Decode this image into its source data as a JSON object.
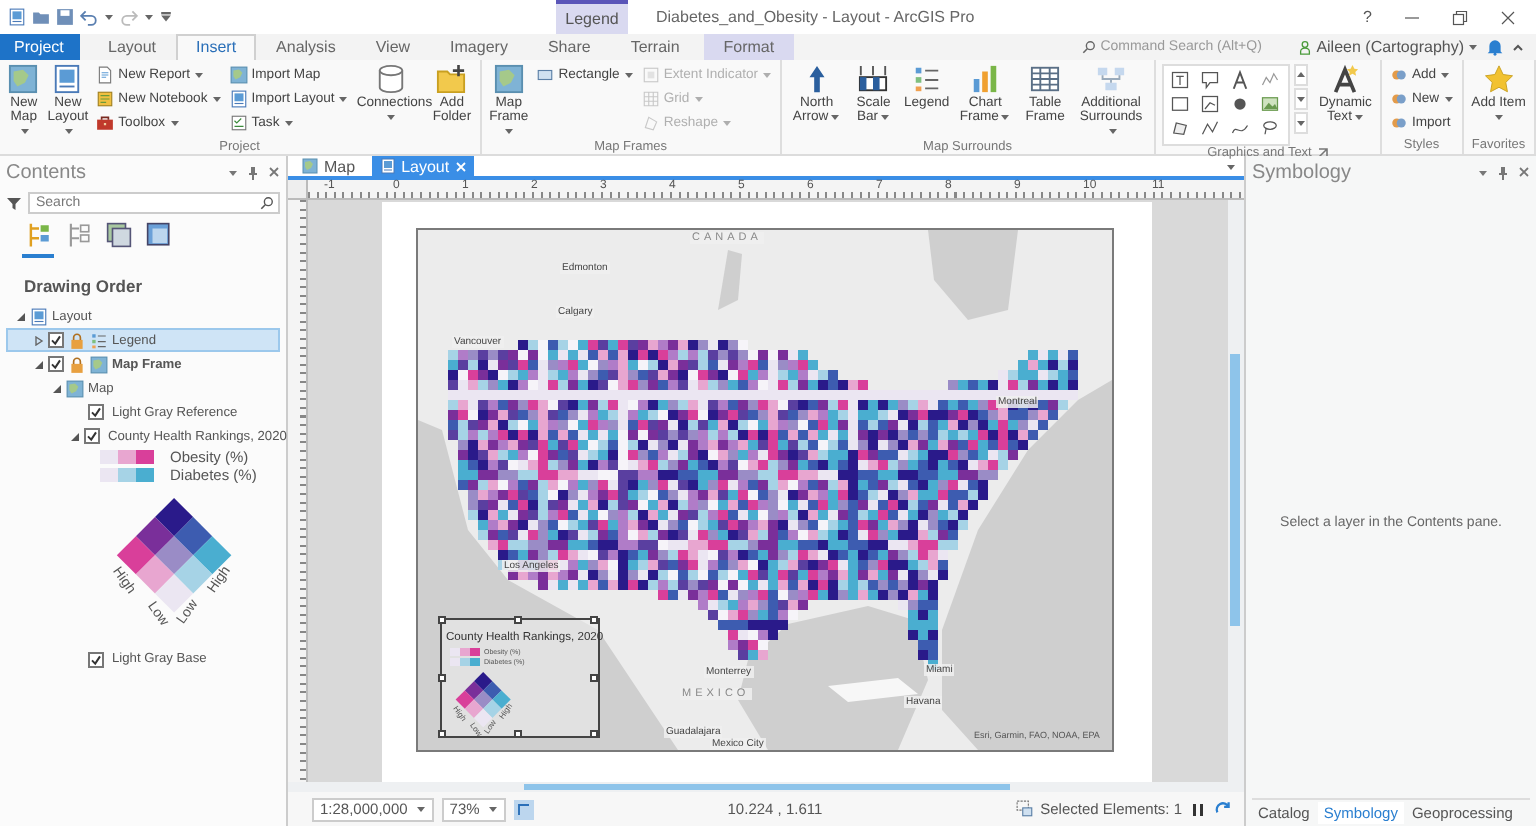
{
  "title_bar": {
    "context_label": "Legend",
    "title": "Diabetes_and_Obesity - Layout - ArcGIS Pro",
    "help": "?"
  },
  "ribbon_tabs": [
    {
      "label": "Project",
      "kind": "backstage",
      "selected": false
    },
    {
      "label": "Layout",
      "kind": "normal",
      "selected": false
    },
    {
      "label": "Insert",
      "kind": "normal",
      "selected": true
    },
    {
      "label": "Analysis",
      "kind": "normal",
      "selected": false
    },
    {
      "label": "View",
      "kind": "normal",
      "selected": false
    },
    {
      "label": "Imagery",
      "kind": "normal",
      "selected": false
    },
    {
      "label": "Share",
      "kind": "normal",
      "selected": false
    },
    {
      "label": "Terrain",
      "kind": "normal",
      "selected": false
    },
    {
      "label": "Format",
      "kind": "contextual",
      "selected": false
    }
  ],
  "command_search": {
    "placeholder": "Command Search (Alt+Q)"
  },
  "user": {
    "label": "Aileen (Cartography)",
    "dropdown": true
  },
  "ribbon_groups": [
    {
      "label": "Project",
      "launcher": false,
      "items": [
        {
          "kind": "large",
          "label": "New Map",
          "dropdown": true,
          "disabled": false
        },
        {
          "kind": "large",
          "label": "New Layout",
          "dropdown": true,
          "disabled": false
        },
        {
          "kind": "stack",
          "items": [
            {
              "label": "New Report",
              "dropdown": true,
              "disabled": false
            },
            {
              "label": "New Notebook",
              "dropdown": true,
              "disabled": false
            },
            {
              "label": "Toolbox",
              "dropdown": true,
              "disabled": false
            }
          ]
        },
        {
          "kind": "stack",
          "items": [
            {
              "label": "Import Map",
              "dropdown": false,
              "disabled": false
            },
            {
              "label": "Import Layout",
              "dropdown": true,
              "disabled": false
            },
            {
              "label": "Task",
              "dropdown": true,
              "disabled": false
            }
          ]
        },
        {
          "kind": "large",
          "label": "Connections",
          "dropdown": true,
          "disabled": false
        },
        {
          "kind": "large",
          "label": "Add Folder",
          "dropdown": false,
          "disabled": false
        }
      ]
    },
    {
      "label": "Map Frames",
      "launcher": false,
      "items": [
        {
          "kind": "large",
          "label": "Map Frame",
          "dropdown": true,
          "disabled": false
        },
        {
          "kind": "stack",
          "items": [
            {
              "label": "Rectangle",
              "dropdown": true,
              "disabled": false
            }
          ]
        },
        {
          "kind": "stack",
          "items": [
            {
              "label": "Extent Indicator",
              "dropdown": true,
              "disabled": true
            },
            {
              "label": "Grid",
              "dropdown": true,
              "disabled": true
            },
            {
              "label": "Reshape",
              "dropdown": true,
              "disabled": true
            }
          ]
        }
      ]
    },
    {
      "label": "Map Surrounds",
      "launcher": false,
      "items": [
        {
          "kind": "large",
          "label": "North Arrow",
          "dropdown": true,
          "disabled": false
        },
        {
          "kind": "large",
          "label": "Scale Bar",
          "dropdown": true,
          "disabled": false
        },
        {
          "kind": "large",
          "label": "Legend",
          "dropdown": false,
          "disabled": false
        },
        {
          "kind": "large",
          "label": "Chart Frame",
          "dropdown": true,
          "disabled": false
        },
        {
          "kind": "large",
          "label": "Table Frame",
          "dropdown": false,
          "disabled": false
        },
        {
          "kind": "large",
          "label": "Additional Surrounds",
          "dropdown": true,
          "disabled": false
        }
      ]
    },
    {
      "label": "Graphics and Text",
      "launcher": true,
      "items": [
        {
          "kind": "gallery"
        },
        {
          "kind": "large",
          "label": "Dynamic Text",
          "dropdown": true,
          "disabled": false
        }
      ]
    },
    {
      "label": "Styles",
      "launcher": false,
      "items": [
        {
          "kind": "stack",
          "items": [
            {
              "label": "Add",
              "dropdown": true,
              "disabled": false
            },
            {
              "label": "New",
              "dropdown": true,
              "disabled": false
            },
            {
              "label": "Import",
              "dropdown": false,
              "disabled": false
            }
          ]
        }
      ]
    },
    {
      "label": "Favorites",
      "launcher": false,
      "items": [
        {
          "kind": "large",
          "label": "Add Item",
          "dropdown": true,
          "disabled": false
        }
      ]
    }
  ],
  "contents": {
    "title": "Contents",
    "search": {
      "placeholder": "Search"
    },
    "view_tabs": [
      {
        "selected": true
      },
      {
        "selected": false
      },
      {
        "selected": false
      },
      {
        "selected": false
      }
    ],
    "heading": "Drawing Order",
    "tree": [
      {
        "label": "Layout",
        "kind": "layout",
        "expanded": true,
        "selected": false,
        "active": false,
        "children": [
          {
            "label": "Legend",
            "kind": "element",
            "expanded": false,
            "checked": true,
            "selected": true,
            "active": false
          },
          {
            "label": "Map Frame",
            "kind": "mapframe",
            "expanded": true,
            "checked": true,
            "selected": false,
            "active": true,
            "children": [
              {
                "label": "Map",
                "kind": "map",
                "expanded": true,
                "selected": false,
                "active": false,
                "children": [
                  {
                    "label": "Light Gray Reference",
                    "kind": "layer",
                    "checked": true,
                    "selected": false,
                    "active": false
                  },
                  {
                    "label": "County Health Rankings, 2020",
                    "kind": "layer",
                    "expanded": true,
                    "checked": true,
                    "selected": false,
                    "active": false,
                    "legend": {
                      "rows": [
                        {
                          "label": "Obesity (%)",
                          "swatches": [
                            {
                              "color": "#ebe6f2"
                            },
                            {
                              "color": "#e8a6d0"
                            },
                            {
                              "color": "#d93f9a"
                            }
                          ]
                        },
                        {
                          "label": "Diabetes (%)",
                          "swatches": [
                            {
                              "color": "#ebe6f2"
                            },
                            {
                              "color": "#a6d3e6"
                            },
                            {
                              "color": "#4aaed0"
                            }
                          ]
                        }
                      ],
                      "cells": [
                        {
                          "color": "#2a1a8a"
                        },
                        {
                          "color": "#3d5cb0"
                        },
                        {
                          "color": "#4aaed0"
                        },
                        {
                          "color": "#7a2f9a"
                        },
                        {
                          "color": "#9a8cc6"
                        },
                        {
                          "color": "#a6d3e6"
                        },
                        {
                          "color": "#d93f9a"
                        },
                        {
                          "color": "#e8a6d0"
                        },
                        {
                          "color": "#ebe6f2"
                        }
                      ],
                      "axis_labels": [
                        "High",
                        "Low",
                        "Low",
                        "High"
                      ]
                    }
                  },
                  {
                    "label": "Light Gray Base",
                    "kind": "layer",
                    "checked": true,
                    "selected": false,
                    "active": false
                  }
                ]
              }
            ]
          }
        ]
      }
    ]
  },
  "document_tabs": [
    {
      "label": "Map",
      "selected": false,
      "closable": false
    },
    {
      "label": "Layout",
      "selected": true,
      "closable": true
    }
  ],
  "ruler": {
    "labels": [
      "-1",
      "0",
      "1",
      "2",
      "3",
      "4",
      "5",
      "6",
      "7",
      "8",
      "9",
      "10",
      "11"
    ]
  },
  "layout_view": {
    "map_labels": [
      {
        "label": "CANADA",
        "kind": "country"
      },
      {
        "label": "Edmonton",
        "kind": "city"
      },
      {
        "label": "Calgary",
        "kind": "city"
      },
      {
        "label": "Vancouver",
        "kind": "city"
      },
      {
        "label": "Montreal",
        "kind": "city"
      },
      {
        "label": "Los Angeles",
        "kind": "city"
      },
      {
        "label": "Monterrey",
        "kind": "city"
      },
      {
        "label": "MEXICO",
        "kind": "country"
      },
      {
        "label": "Guadalajara",
        "kind": "city"
      },
      {
        "label": "Mexico City",
        "kind": "city"
      },
      {
        "label": "Havana",
        "kind": "city"
      },
      {
        "label": "Miami",
        "kind": "city"
      }
    ],
    "attribution": "Esri, Garmin, FAO, NOAA, EPA",
    "legend": {
      "title": "County Health Rankings, 2020",
      "selected": true,
      "rows": [
        {
          "label": "Obesity (%)",
          "swatches": [
            {
              "color": "#ebe6f2"
            },
            {
              "color": "#e8a6d0"
            },
            {
              "color": "#d93f9a"
            }
          ]
        },
        {
          "label": "Diabetes (%)",
          "swatches": [
            {
              "color": "#ebe6f2"
            },
            {
              "color": "#a6d3e6"
            },
            {
              "color": "#4aaed0"
            }
          ]
        }
      ],
      "cells": [
        {
          "color": "#2a1a8a"
        },
        {
          "color": "#3d5cb0"
        },
        {
          "color": "#4aaed0"
        },
        {
          "color": "#7a2f9a"
        },
        {
          "color": "#9a8cc6"
        },
        {
          "color": "#a6d3e6"
        },
        {
          "color": "#d93f9a"
        },
        {
          "color": "#e8a6d0"
        },
        {
          "color": "#ebe6f2"
        }
      ],
      "axis_labels": [
        "High",
        "Low",
        "Low",
        "High"
      ]
    }
  },
  "status_bar": {
    "scale": "1:28,000,000",
    "zoom": "73%",
    "coordinates": "10.224 , 1.611",
    "selection": "Selected Elements: 1"
  },
  "symbology": {
    "title": "Symbology",
    "message": "Select a layer in the Contents pane."
  },
  "pane_tabs": [
    {
      "label": "Catalog",
      "selected": false
    },
    {
      "label": "Symbology",
      "selected": true
    },
    {
      "label": "Geoprocessing",
      "selected": false
    }
  ]
}
